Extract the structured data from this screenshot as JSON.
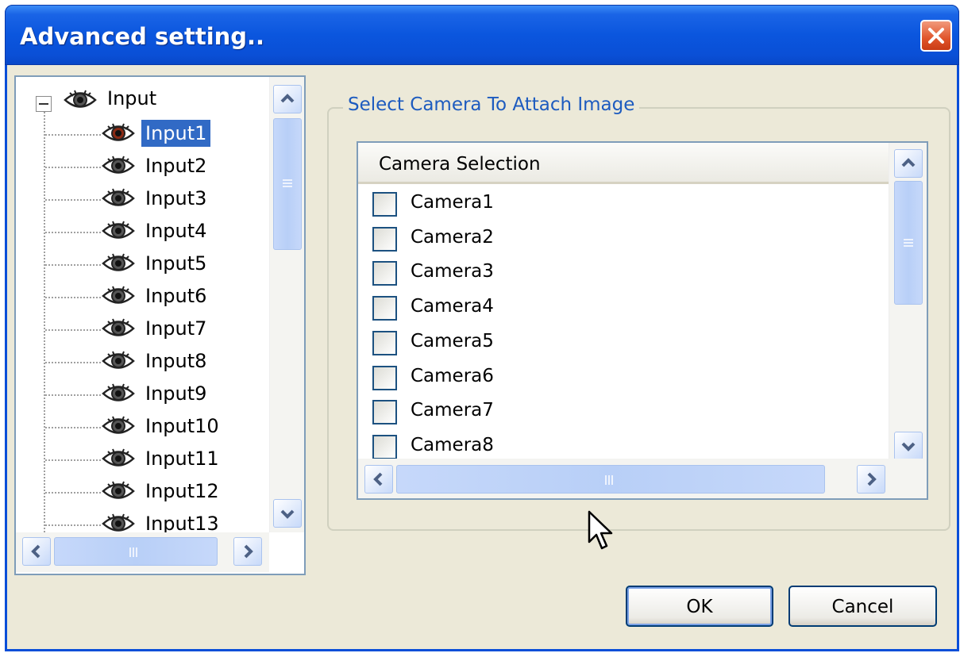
{
  "window": {
    "title": "Advanced setting.."
  },
  "tree": {
    "root": {
      "label": "Input",
      "expander": "minus"
    },
    "items": [
      {
        "label": "Input1",
        "selected": true
      },
      {
        "label": "Input2"
      },
      {
        "label": "Input3"
      },
      {
        "label": "Input4"
      },
      {
        "label": "Input5"
      },
      {
        "label": "Input6"
      },
      {
        "label": "Input7"
      },
      {
        "label": "Input8"
      },
      {
        "label": "Input9"
      },
      {
        "label": "Input10"
      },
      {
        "label": "Input11"
      },
      {
        "label": "Input12"
      },
      {
        "label": "Input13"
      }
    ],
    "icon": "eye-icon"
  },
  "group": {
    "title": "Select Camera To Attach Image",
    "list_header": "Camera Selection",
    "cameras": [
      {
        "label": "Camera1",
        "checked": false
      },
      {
        "label": "Camera2",
        "checked": false
      },
      {
        "label": "Camera3",
        "checked": false
      },
      {
        "label": "Camera4",
        "checked": false
      },
      {
        "label": "Camera5",
        "checked": false
      },
      {
        "label": "Camera6",
        "checked": false
      },
      {
        "label": "Camera7",
        "checked": false
      },
      {
        "label": "Camera8",
        "checked": false
      }
    ]
  },
  "buttons": {
    "ok": "OK",
    "cancel": "Cancel"
  },
  "colors": {
    "titlebar": "#0b56de",
    "selection": "#316ac5",
    "group_title": "#1d5bbf",
    "close_button": "#e0542a",
    "dialog_bg": "#ece9d8"
  }
}
